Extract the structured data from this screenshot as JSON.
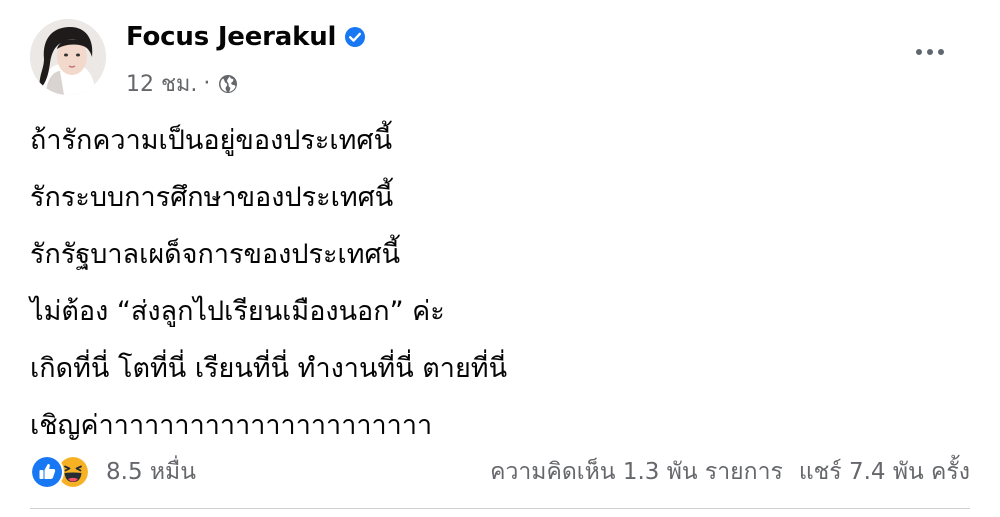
{
  "post": {
    "author": "Focus Jeerakul",
    "timestamp": "12 ชม.",
    "meta_separator": "·",
    "verified_icon": "verified-badge-icon",
    "privacy_icon": "globe-icon",
    "lines": [
      "ถ้ารักความเป็นอยู่ของประเทศนี้",
      "รักระบบการศึกษาของประเทศนี้",
      "รักรัฐบาลเผด็จการของประเทศนี้",
      "ไม่ต้อง “ส่งลูกไปเรียนเมืองนอก” ค่ะ",
      "เกิดที่นี่ โตที่นี่ เรียนที่นี่ ทำงานที่นี่ ตายที่นี่",
      "เชิญค่าาาาาาาาาาาาาาาาาาาาาา"
    ]
  },
  "stats": {
    "reactions_count": "8.5 หมื่น",
    "reaction_icons": [
      "like-icon",
      "haha-icon"
    ],
    "comments": "ความคิดเห็น 1.3 พัน รายการ",
    "shares": "แชร์ 7.4 พัน ครั้ง"
  },
  "colors": {
    "text_primary": "#050505",
    "text_secondary": "#65676b",
    "facebook_blue": "#1877f2",
    "haha_yellow": "#f7b125"
  }
}
